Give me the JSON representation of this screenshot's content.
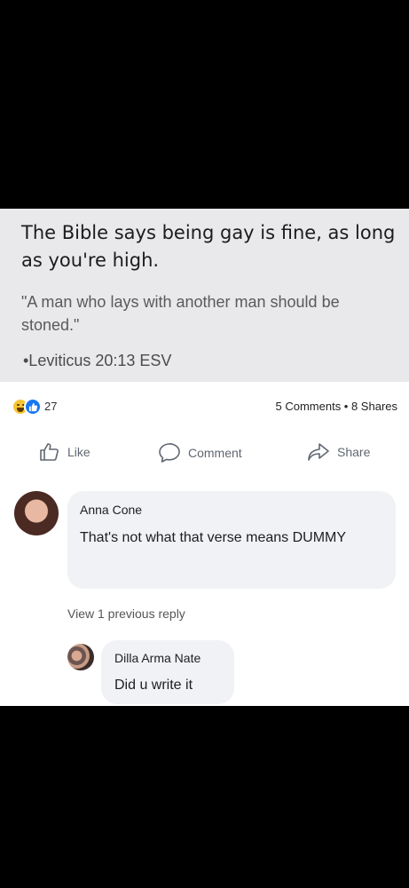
{
  "meme": {
    "title": "The Bible says being gay is fine, as long as you're high.",
    "quote": "\"A man who lays with another man should be stoned.\"",
    "citation": "•Leviticus 20:13 ESV"
  },
  "stats": {
    "reaction_count": "27",
    "comments_shares": "5 Comments • 8 Shares"
  },
  "actions": {
    "like": "Like",
    "comment": "Comment",
    "share": "Share"
  },
  "comments": [
    {
      "author": "Anna Cone",
      "text": "That's not what that verse means DUMMY"
    },
    {
      "author": "Dilla Arma Nate",
      "text": "Did u write it"
    }
  ],
  "view_replies": "View 1 previous reply",
  "colors": {
    "meme_bg": "#e9e9eb",
    "like_blue": "#1877f2",
    "haha_yellow": "#f7c62f",
    "bubble_bg": "#f0f2f5"
  }
}
